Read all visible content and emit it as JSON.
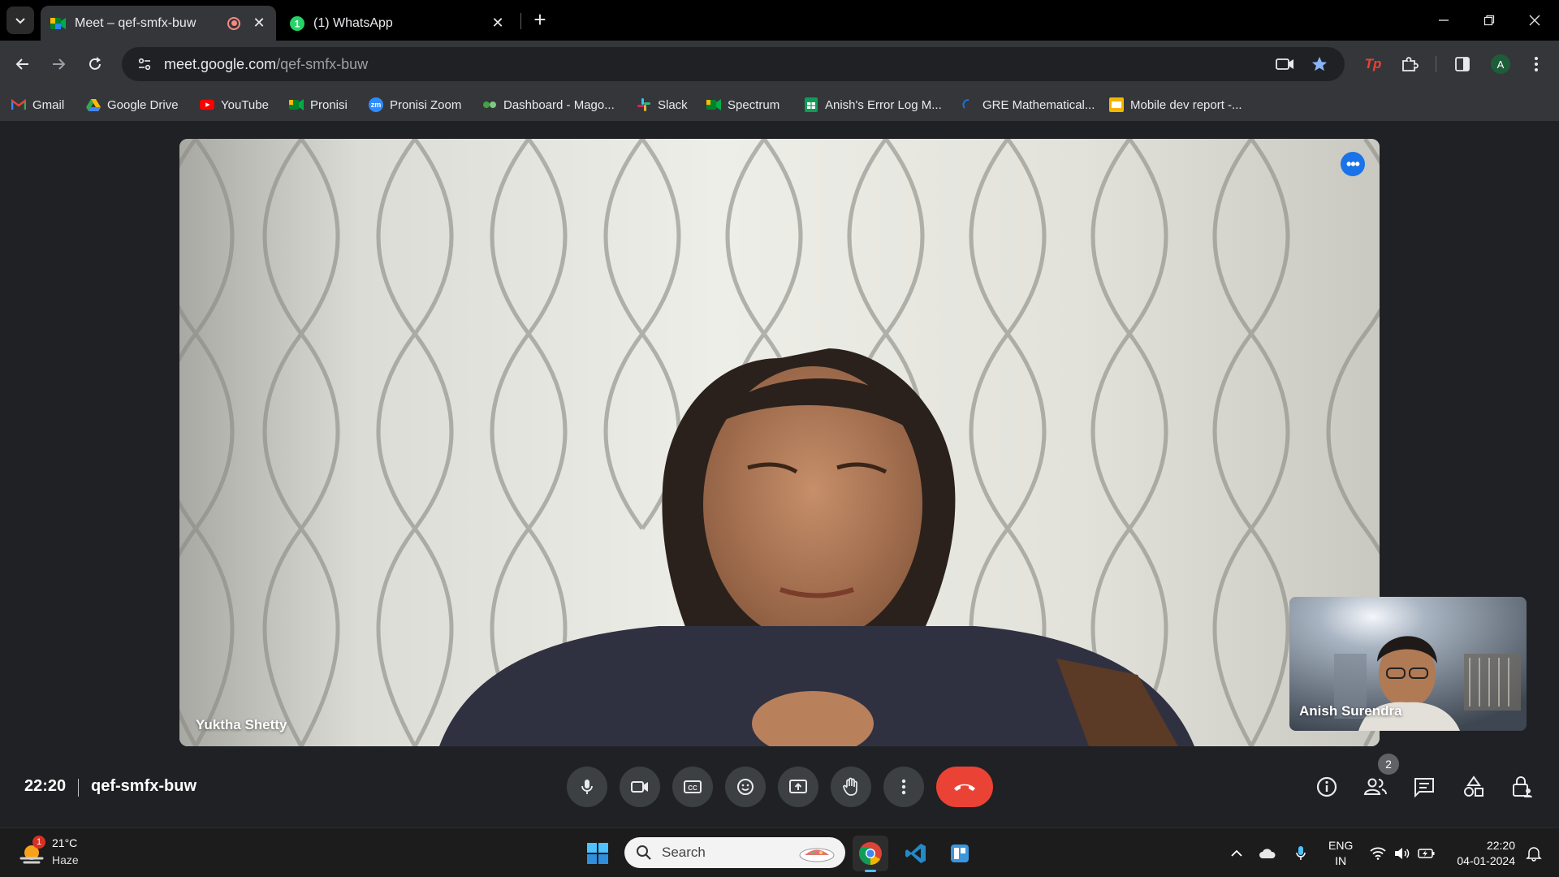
{
  "browser": {
    "tabs": [
      {
        "title": "Meet – qef-smfx-buw",
        "active": true,
        "recording": true
      },
      {
        "title": "(1) WhatsApp",
        "active": false,
        "badge": "1"
      }
    ],
    "url_host": "meet.google.com",
    "url_path": "/qef-smfx-buw",
    "profile_initial": "A",
    "extension_label": "Tp"
  },
  "bookmarks": [
    {
      "label": "Gmail",
      "icon": "gmail-icon",
      "color": "#ea4335"
    },
    {
      "label": "Google Drive",
      "icon": "drive-icon",
      "color": "#34a853"
    },
    {
      "label": "YouTube",
      "icon": "youtube-icon",
      "color": "#ff0000"
    },
    {
      "label": "Pronisi",
      "icon": "meet-icon",
      "color": "#00897b"
    },
    {
      "label": "Pronisi Zoom",
      "icon": "zoom-icon",
      "color": "#2d8cff",
      "glyph": "zm"
    },
    {
      "label": "Dashboard - Mago...",
      "icon": "dashboard-icon",
      "color": "#43a047"
    },
    {
      "label": "Slack",
      "icon": "slack-icon",
      "color": "#e01e5a"
    },
    {
      "label": "Spectrum",
      "icon": "meet-icon",
      "color": "#00897b"
    },
    {
      "label": "Anish's Error Log M...",
      "icon": "sheets-icon",
      "color": "#0f9d58"
    },
    {
      "label": "GRE Mathematical...",
      "icon": "loading-icon",
      "color": "#1a73e8"
    },
    {
      "label": "Mobile dev report -...",
      "icon": "slides-icon",
      "color": "#f4b400"
    }
  ],
  "meet": {
    "main_participant": "Yuktha Shetty",
    "self_participant": "Anish Surendra",
    "time": "22:20",
    "meeting_code": "qef-smfx-buw",
    "people_count": "2",
    "more_glyph": "•••"
  },
  "taskbar": {
    "weather_temp": "21°C",
    "weather_desc": "Haze",
    "weather_badge": "1",
    "search_label": "Search",
    "lang_top": "ENG",
    "lang_bottom": "IN",
    "clock_time": "22:20",
    "clock_date": "04-01-2024"
  },
  "colors": {
    "end_call": "#ea4335",
    "accent_blue": "#1a73e8",
    "meet_bg": "#202124"
  }
}
